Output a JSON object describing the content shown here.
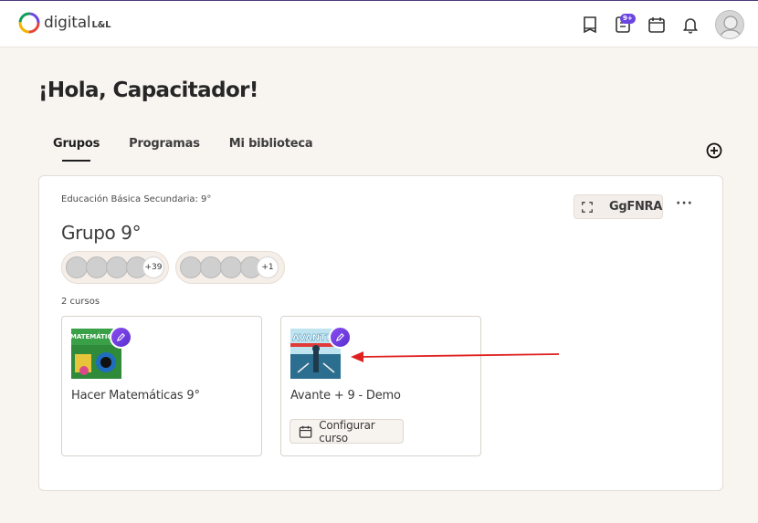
{
  "header": {
    "brand_name": "digital",
    "brand_suffix": "L&L",
    "notification_badge": "9+",
    "icons": [
      "book-icon",
      "task-list-icon",
      "calendar-icon",
      "bell-icon",
      "user-avatar"
    ]
  },
  "page": {
    "greeting": "¡Hola, Capacitador!"
  },
  "tabs": [
    {
      "label": "Grupos",
      "active": true
    },
    {
      "label": "Programas",
      "active": false
    },
    {
      "label": "Mi biblioteca",
      "active": false
    }
  ],
  "group": {
    "subtitle": "Educación Básica Secundaria: 9°",
    "title": "Grupo 9°",
    "code": "GgFNRA",
    "students_extra": "+39",
    "teachers_extra": "+1",
    "courses_count": "2 cursos"
  },
  "courses": [
    {
      "title": "Hacer Matemáticas 9°",
      "thumb_text": "MATEMÁTICAS"
    },
    {
      "title": "Avante + 9 - Demo",
      "thumb_text": "AVANTE",
      "config_label": "Configurar curso"
    }
  ],
  "colors": {
    "accent": "#6b45e0",
    "annotation_arrow": "#e02020",
    "background": "#f8f5f1"
  }
}
